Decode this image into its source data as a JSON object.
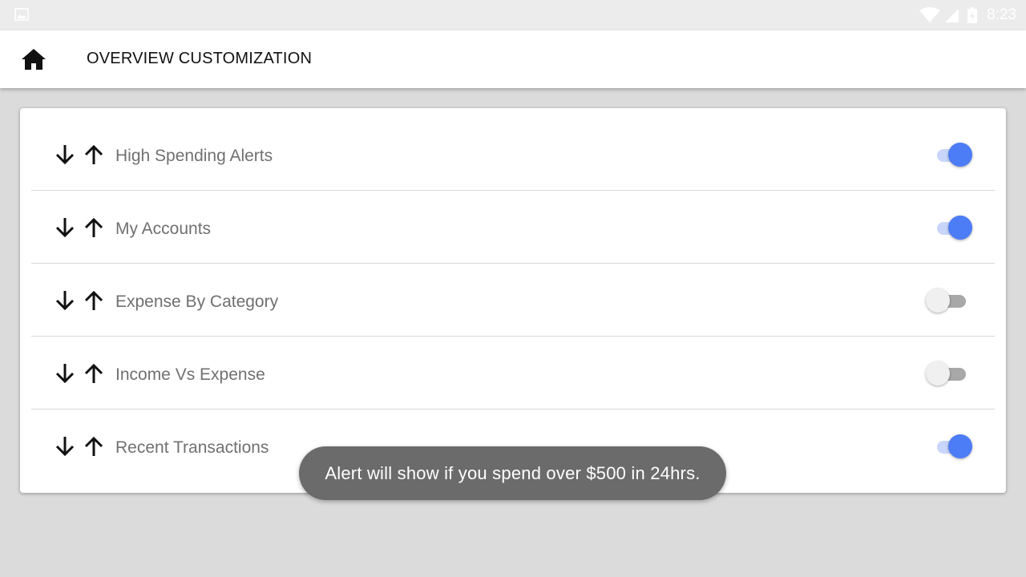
{
  "status_bar": {
    "time": "8:23",
    "icons": [
      "gallery-icon",
      "wifi-icon",
      "signal-icon",
      "battery-charging-icon"
    ]
  },
  "app_bar": {
    "home_icon": "home-icon",
    "title": "OVERVIEW CUSTOMIZATION"
  },
  "widgets": {
    "items": [
      {
        "label": "High Spending Alerts",
        "enabled": true
      },
      {
        "label": "My Accounts",
        "enabled": true
      },
      {
        "label": "Expense By Category",
        "enabled": false
      },
      {
        "label": "Income Vs Expense",
        "enabled": false
      },
      {
        "label": "Recent Transactions",
        "enabled": true
      }
    ],
    "move_down_icon": "arrow-down-icon",
    "move_up_icon": "arrow-up-icon"
  },
  "toast": {
    "message": "Alert will show if you spend over $500 in 24hrs."
  },
  "colors": {
    "accent": "#4d7cf7",
    "accent_track": "#c9d6fb",
    "toast_bg": "#6b6b6b",
    "page_bg": "#dbdbdb"
  }
}
